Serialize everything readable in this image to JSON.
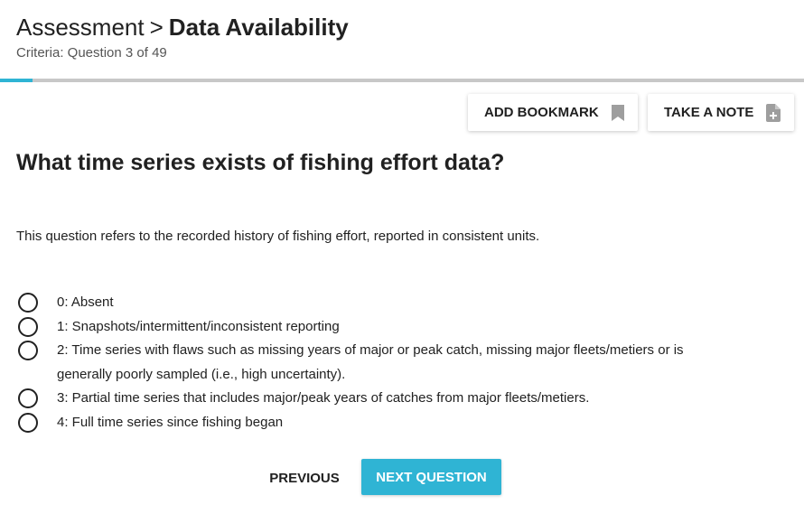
{
  "header": {
    "section": "Assessment",
    "separator": ">",
    "current": "Data Availability",
    "criteria": "Criteria: Question 3 of 49"
  },
  "progress": {
    "current_question": 3,
    "total_questions": 49,
    "fraction": 0.0408
  },
  "colors": {
    "accent": "#2fb4d4",
    "track": "#c8c8c8",
    "text": "#212121",
    "icon_grey": "#9e9e9e"
  },
  "toolbar": {
    "bookmark_label": "ADD BOOKMARK",
    "bookmark_icon": "bookmark-icon",
    "note_label": "TAKE A NOTE",
    "note_icon": "note-add-icon"
  },
  "question": {
    "title": "What time series exists of fishing effort data?",
    "description": "This question refers to the recorded history of fishing effort, reported in consistent units."
  },
  "options": [
    {
      "label": "0: Absent",
      "selected": false
    },
    {
      "label": "1: Snapshots/intermittent/inconsistent reporting",
      "selected": false
    },
    {
      "label": "2: Time series with flaws such as missing years of major or peak catch, missing major fleets/metiers or is generally poorly sampled (i.e., high uncertainty).",
      "selected": false
    },
    {
      "label": "3: Partial time series that includes major/peak years of catches from major fleets/metiers.",
      "selected": false
    },
    {
      "label": "4: Full time series since fishing began",
      "selected": false
    }
  ],
  "navigation": {
    "previous_label": "PREVIOUS",
    "next_label": "NEXT QUESTION"
  }
}
